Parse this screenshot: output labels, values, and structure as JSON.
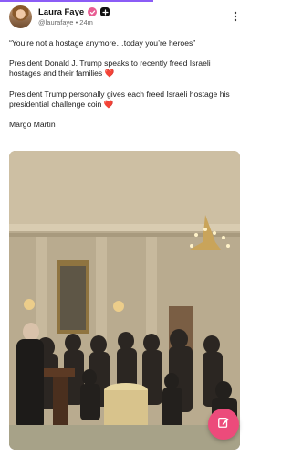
{
  "post": {
    "author_name": "Laura Faye",
    "handle": "@laurafaye",
    "separator": "•",
    "time_ago": "24m",
    "paragraphs": [
      "“You’re not a hostage anymore…today you’re heroes”",
      "President Donald J. Trump speaks to recently freed Israeli hostages and their families",
      "President Trump personally gives each freed Israeli hostage his presidential challenge coin",
      "Margo Martin"
    ],
    "heart_glyph": "❤️"
  },
  "icons": {
    "verified": "verified-badge-icon",
    "plus": "plus-badge-icon",
    "more": "more-vertical-icon",
    "compose": "compose-pencil-icon"
  },
  "colors": {
    "accent": "#8b5cf6",
    "fab": "#ec4b7b",
    "verified_badge": "#e85d93",
    "heart": "#e53935"
  }
}
